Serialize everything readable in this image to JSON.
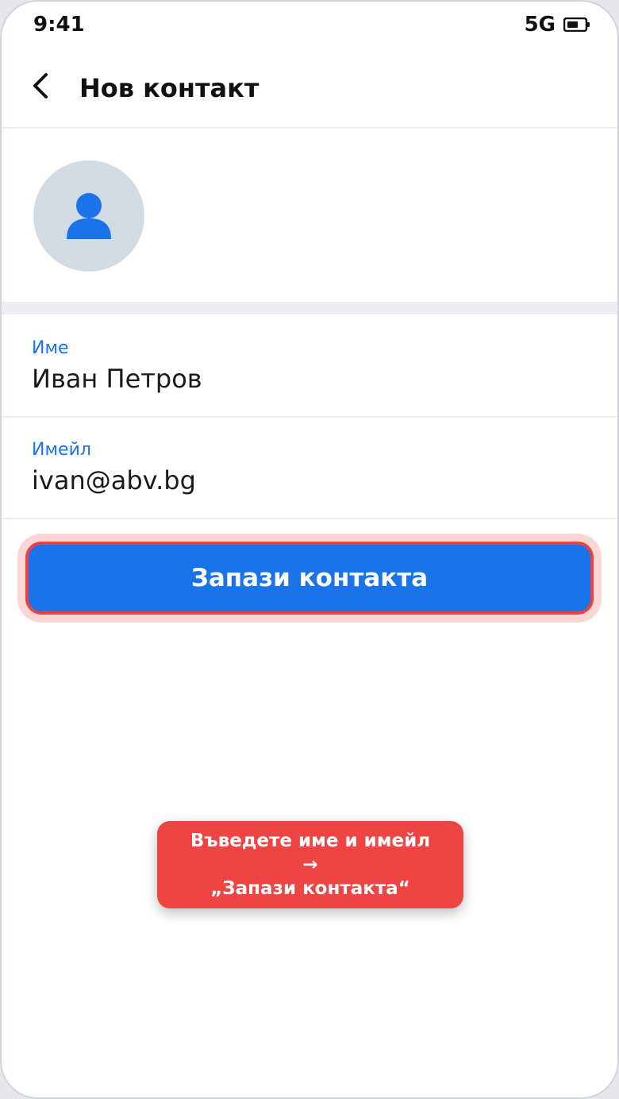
{
  "status_bar": {
    "time": "9:41",
    "network": "5G",
    "battery_icon": "battery-icon"
  },
  "header": {
    "back_icon": "chevron-left-icon",
    "title": "Нов контакт"
  },
  "avatar": {
    "icon": "person-icon",
    "background": "#d2dae4",
    "icon_color": "#1a73e8"
  },
  "form": {
    "name": {
      "label": "Име",
      "value": "Иван Петров"
    },
    "email": {
      "label": "Имейл",
      "value": "ivan@abv.bg"
    }
  },
  "save_button": {
    "label": "Запази контакта",
    "color": "#1a73e8",
    "highlight_color": "#e84242"
  },
  "toast": {
    "line1": "Въведете име и имейл",
    "line2": "→",
    "line3": "„Запази контакта“",
    "color": "#ef4444"
  }
}
